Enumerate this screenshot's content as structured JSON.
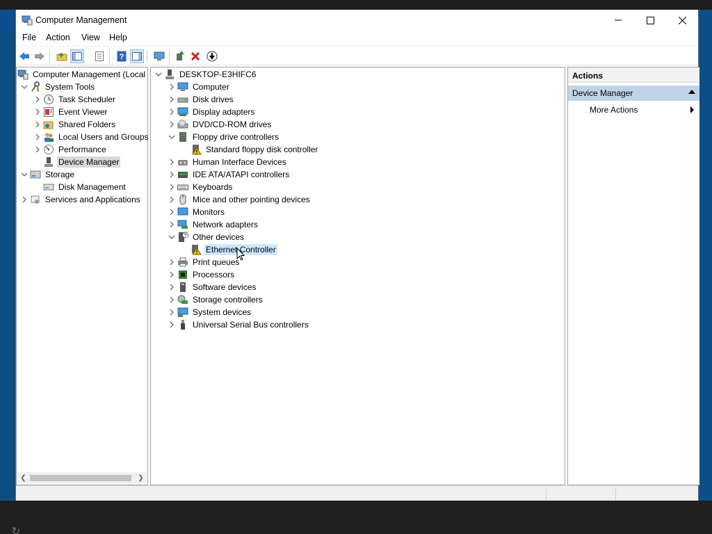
{
  "window": {
    "title": "Computer Management"
  },
  "menu": [
    "File",
    "Action",
    "View",
    "Help"
  ],
  "toolbar": {
    "buttons": [
      "back-icon",
      "forward-icon",
      "up-folder-icon",
      "show-hide-console-tree-icon",
      "properties-icon",
      "help-icon",
      "show-hide-action-pane-icon",
      "computer-icon",
      "update-driver-icon",
      "uninstall-icon",
      "download-icon"
    ]
  },
  "left_tree": {
    "root": "Computer Management (Local",
    "system_tools": "System Tools",
    "items": [
      "Task Scheduler",
      "Event Viewer",
      "Shared Folders",
      "Local Users and Groups",
      "Performance",
      "Device Manager"
    ],
    "storage": "Storage",
    "disk_management": "Disk Management",
    "services": "Services and Applications"
  },
  "device_tree": {
    "root": "DESKTOP-E3HIFC6",
    "categories": [
      "Computer",
      "Disk drives",
      "Display adapters",
      "DVD/CD-ROM drives",
      "Floppy drive controllers",
      "Standard floppy disk controller",
      "Human Interface Devices",
      "IDE ATA/ATAPI controllers",
      "Keyboards",
      "Mice and other pointing devices",
      "Monitors",
      "Network adapters",
      "Other devices",
      "Ethernet Controller",
      "Print queues",
      "Processors",
      "Software devices",
      "Storage controllers",
      "System devices",
      "Universal Serial Bus controllers"
    ]
  },
  "actions": {
    "header": "Actions",
    "section": "Device Manager",
    "item": "More Actions"
  },
  "colors": {
    "desktop": "#0a4f8a",
    "selection": "#cce8ff",
    "actions_section": "#bfd3e8",
    "warning": "#f5c400"
  }
}
